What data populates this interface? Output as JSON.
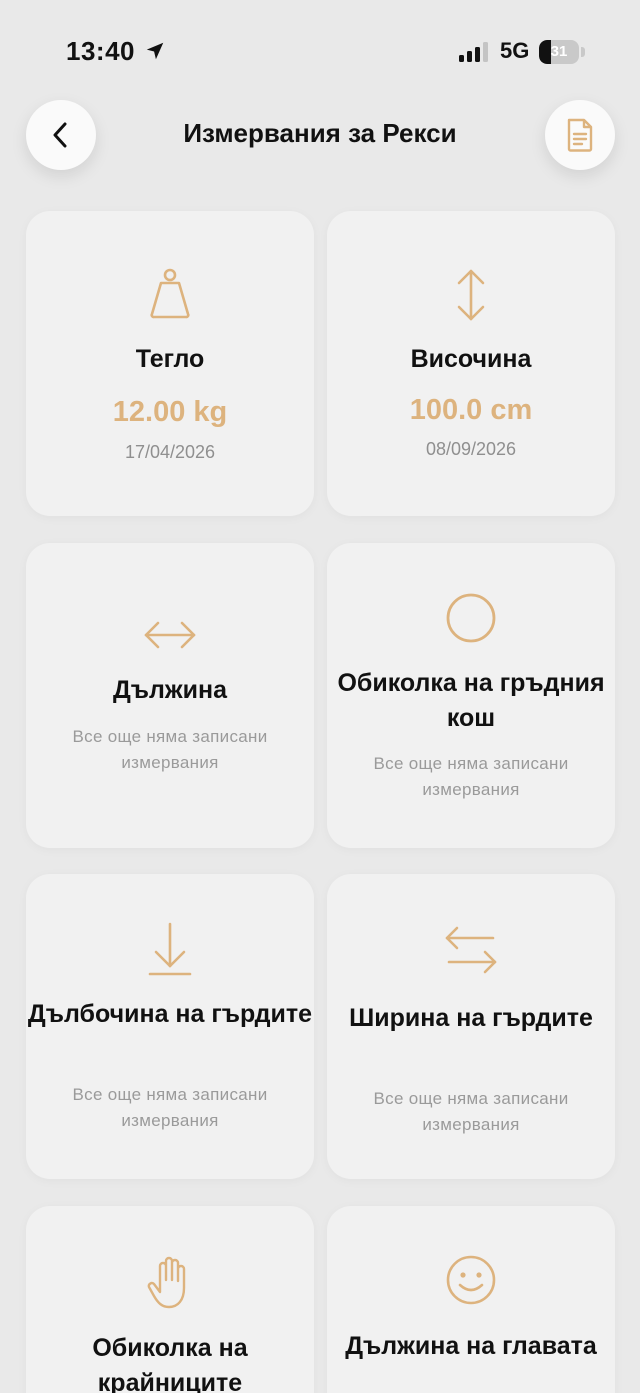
{
  "status_bar": {
    "time": "13:40",
    "network": "5G",
    "battery_level": "31",
    "battery_fraction": 0.31
  },
  "header": {
    "title": "Измервания за Рекси",
    "back_icon": "chevron-left-icon",
    "document_icon": "document-icon"
  },
  "colors": {
    "accent": "#ddb37e",
    "background": "#e9e9e9",
    "card": "#f1f1f1",
    "muted_text": "#9a9a9a"
  },
  "cards": [
    {
      "icon": "weight-icon",
      "name": "Тегло",
      "value": "12.00 kg",
      "date": "17/04/2026"
    },
    {
      "icon": "height-arrows-icon",
      "name": "Височина",
      "value": "100.0 cm",
      "date": "08/09/2026"
    },
    {
      "icon": "length-arrows-icon",
      "name": "Дължина",
      "empty": "Все още няма записани измервания"
    },
    {
      "icon": "circle-icon",
      "name": "Обиколка на гръдния кош",
      "empty": "Все още няма записани измервания"
    },
    {
      "icon": "arrow-down-icon",
      "name": "Дълбочина на гърдите",
      "empty": "Все още няма записани измервания"
    },
    {
      "icon": "swap-arrows-icon",
      "name": "Ширина на гърдите",
      "empty": "Все още няма записани измервания"
    },
    {
      "icon": "hand-icon",
      "name": "Обиколка на крайниците"
    },
    {
      "icon": "smiley-icon",
      "name": "Дължина на главата"
    }
  ]
}
